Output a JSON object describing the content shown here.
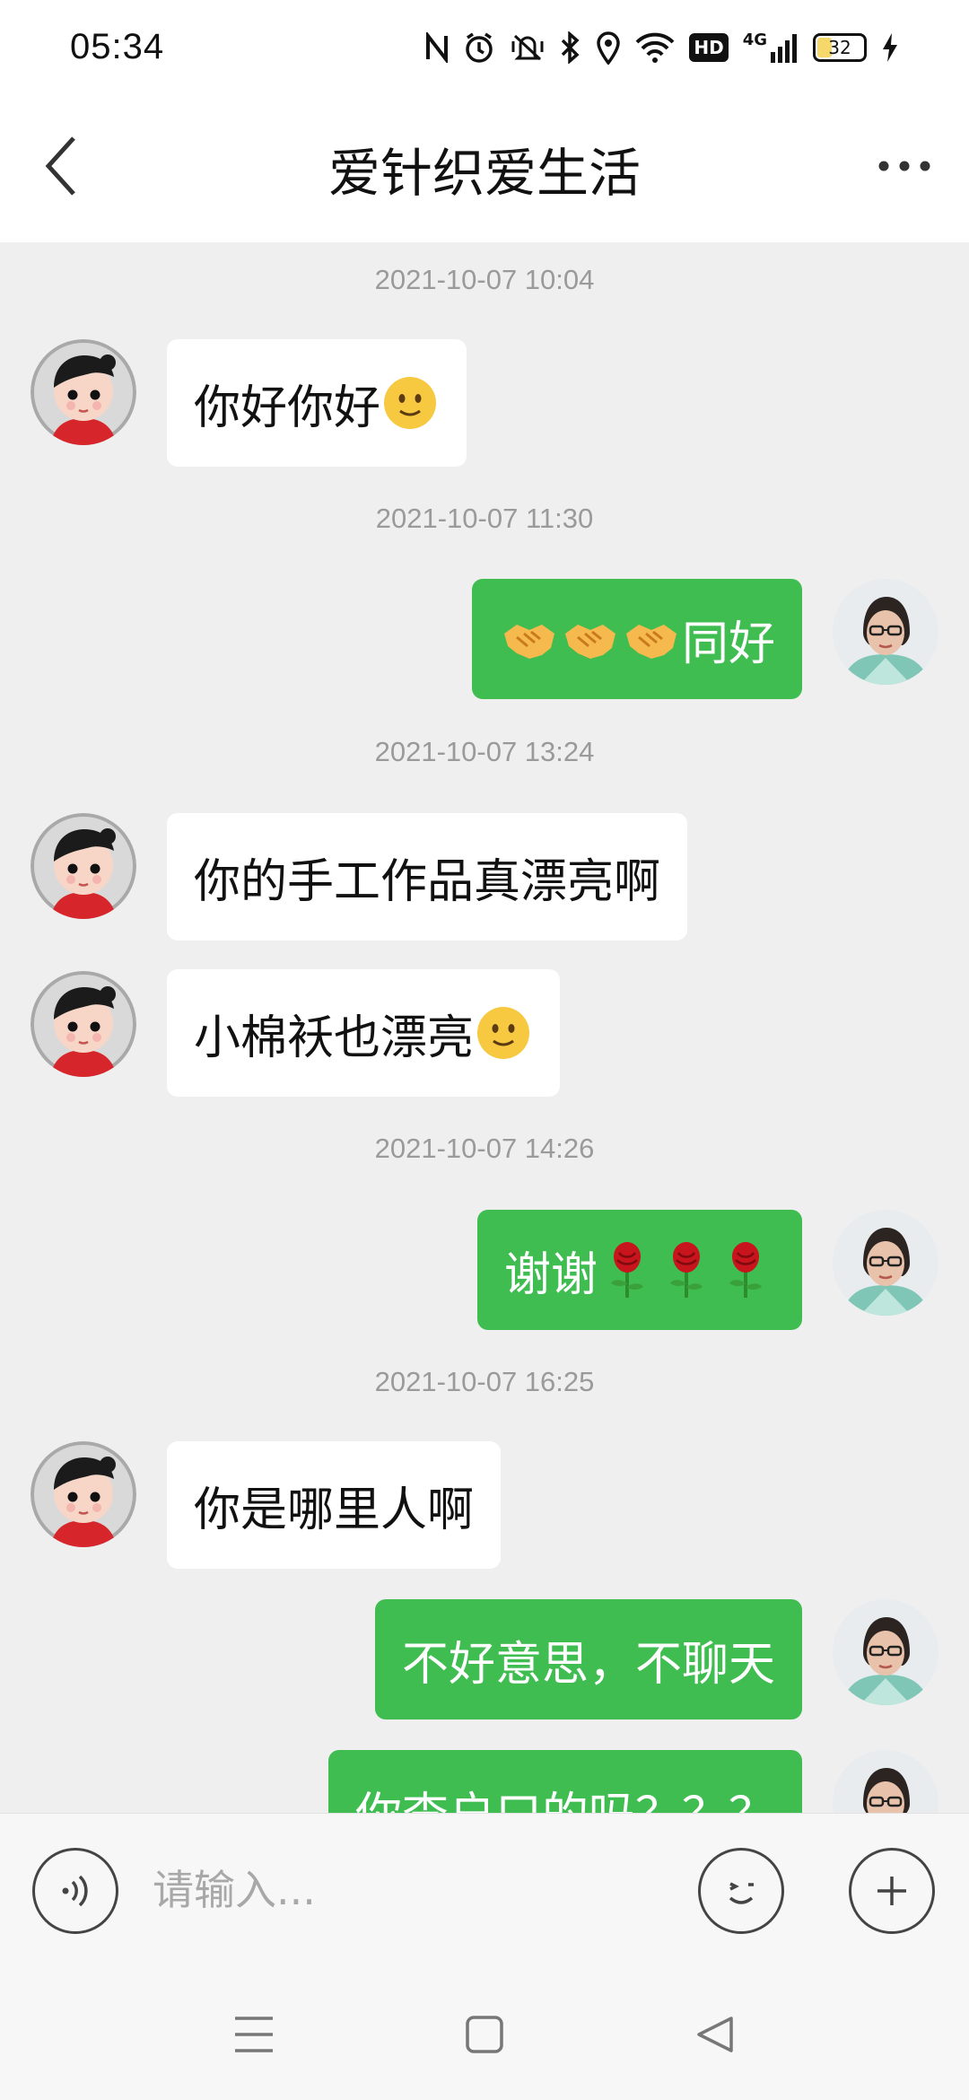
{
  "status_bar": {
    "time": "05:34",
    "icons": [
      "nfc-icon",
      "alarm-icon",
      "vibrate-icon",
      "bluetooth-icon",
      "location-icon",
      "wifi-icon",
      "hd-icon",
      "signal-4g-icon",
      "battery-icon",
      "charging-icon"
    ],
    "battery_level": "32",
    "hd_label": "HD",
    "network_label": "4G"
  },
  "header": {
    "title": "爱针织爱生活"
  },
  "timestamps": [
    "2021-10-07 10:04",
    "2021-10-07 11:30",
    "2021-10-07 13:24",
    "2021-10-07 14:26",
    "2021-10-07 16:25"
  ],
  "messages": [
    {
      "side": "in",
      "text": "你好你好",
      "emoji": "smile-emoji"
    },
    {
      "side": "out",
      "text": "同好",
      "emoji": "handshake-emoji x3"
    },
    {
      "side": "in",
      "text": "你的手工作品真漂亮啊"
    },
    {
      "side": "in",
      "text": "小棉袄也漂亮",
      "emoji": "smile-emoji"
    },
    {
      "side": "out",
      "text": "谢谢",
      "emoji": "rose-emoji x3"
    },
    {
      "side": "in",
      "text": "你是哪里人啊"
    },
    {
      "side": "out",
      "text": "不好意思，不聊天"
    },
    {
      "side": "out",
      "text": "你查户口的吗？？？"
    }
  ],
  "input": {
    "placeholder": "请输入..."
  },
  "colors": {
    "outgoing_bubble": "#3fbd51",
    "incoming_bubble": "#ffffff",
    "chat_background": "#efefef"
  }
}
